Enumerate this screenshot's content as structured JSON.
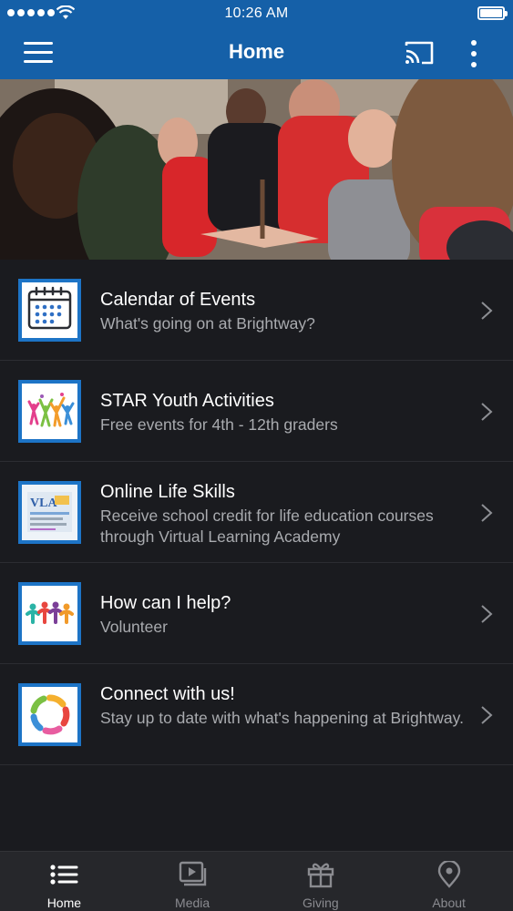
{
  "status_bar": {
    "time": "10:26 AM"
  },
  "header": {
    "title": "Home"
  },
  "colors": {
    "brand": "#1560a8",
    "background": "#1a1b1f",
    "thumb_border": "#1d74c6",
    "subtitle": "#a9abaf"
  },
  "items": [
    {
      "title": "Calendar of Events",
      "subtitle": "What's going on at Brightway?",
      "icon": "calendar-icon"
    },
    {
      "title": "STAR Youth Activities",
      "subtitle": "Free events for 4th - 12th graders",
      "icon": "youth-dancers-icon"
    },
    {
      "title": "Online Life Skills",
      "subtitle": "Receive school credit for life education courses through Virtual Learning Academy",
      "icon": "vla-logo-icon",
      "thumb_text": "VLA"
    },
    {
      "title": "How can I help?",
      "subtitle": "Volunteer",
      "icon": "people-group-icon"
    },
    {
      "title": "Connect with us!",
      "subtitle": "Stay up to date with what's happening at Brightway.",
      "icon": "community-circle-icon"
    }
  ],
  "tabs": [
    {
      "label": "Home",
      "icon": "list-icon",
      "active": true
    },
    {
      "label": "Media",
      "icon": "media-play-icon",
      "active": false
    },
    {
      "label": "Giving",
      "icon": "gift-icon",
      "active": false
    },
    {
      "label": "About",
      "icon": "location-pin-icon",
      "active": false
    }
  ]
}
